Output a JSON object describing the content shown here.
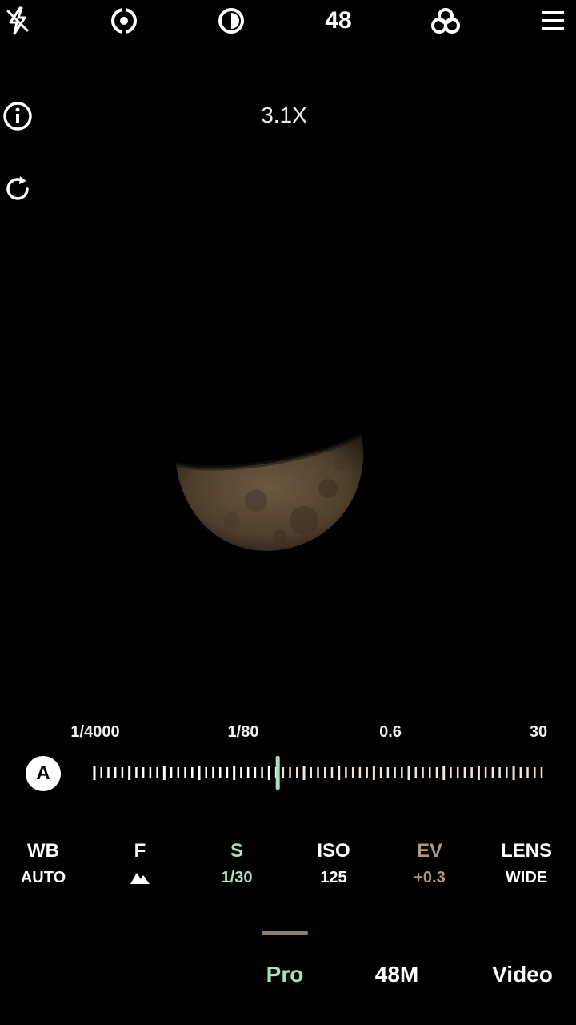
{
  "top_bar": {
    "icons": [
      "flash-off-icon",
      "focus-icon",
      "contrast-icon",
      "filters-icon",
      "menu-icon"
    ],
    "resolution_label": "48"
  },
  "side_icons": [
    "info-icon",
    "refresh-icon"
  ],
  "zoom": {
    "label": "3.1X"
  },
  "shutter_scale": {
    "labels": [
      "1/4000",
      "1/80",
      "0.6",
      "30"
    ],
    "auto_label": "A",
    "value_fraction": 0.41
  },
  "params": [
    {
      "name": "WB",
      "value": "AUTO",
      "color": "#ffffff"
    },
    {
      "name": "F",
      "value": "",
      "icon": "aperture-mountain-icon",
      "color": "#ffffff"
    },
    {
      "name": "S",
      "value": "1/30",
      "color": "#a8e0c0"
    },
    {
      "name": "ISO",
      "value": "125",
      "color": "#ffffff"
    },
    {
      "name": "EV",
      "value": "+0.3",
      "color": "#b09a7a"
    },
    {
      "name": "LENS",
      "value": "WIDE",
      "color": "#ffffff"
    }
  ],
  "modes": [
    {
      "label": "Pro",
      "active": true
    },
    {
      "label": "48M",
      "active": false
    },
    {
      "label": "Video",
      "active": false
    }
  ],
  "colors": {
    "accent": "#a8e0c0",
    "ev": "#b09a7a",
    "indicator": "#8a7f70",
    "moon": "#5a4a36",
    "background": "#000000"
  }
}
